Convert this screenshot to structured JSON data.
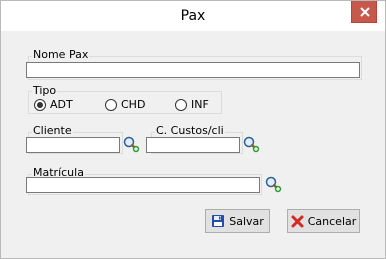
{
  "window": {
    "title": "Pax"
  },
  "form": {
    "nome_pax_label": "Nome Pax",
    "nome_pax_value": "",
    "tipo_label": "Tipo",
    "tipo_options": [
      {
        "label": "ADT",
        "checked": true
      },
      {
        "label": "CHD",
        "checked": false
      },
      {
        "label": "INF",
        "checked": false
      }
    ],
    "cliente_label": "Cliente",
    "cliente_value": "",
    "custos_label": "C. Custos/cli",
    "custos_value": "",
    "matricula_label": "Matrícula",
    "matricula_value": ""
  },
  "buttons": {
    "save_label": "Salvar",
    "cancel_label": "Cancelar"
  },
  "icons": {
    "close": "close-icon",
    "lookup": "search-add-icon",
    "save": "floppy-disk-icon",
    "cancel": "red-x-icon"
  },
  "colors": {
    "close_bg": "#c7584c",
    "dialog_bg": "#f0f0f0",
    "save_icon": "#1f4fa8",
    "cancel_icon": "#d42a1f"
  }
}
